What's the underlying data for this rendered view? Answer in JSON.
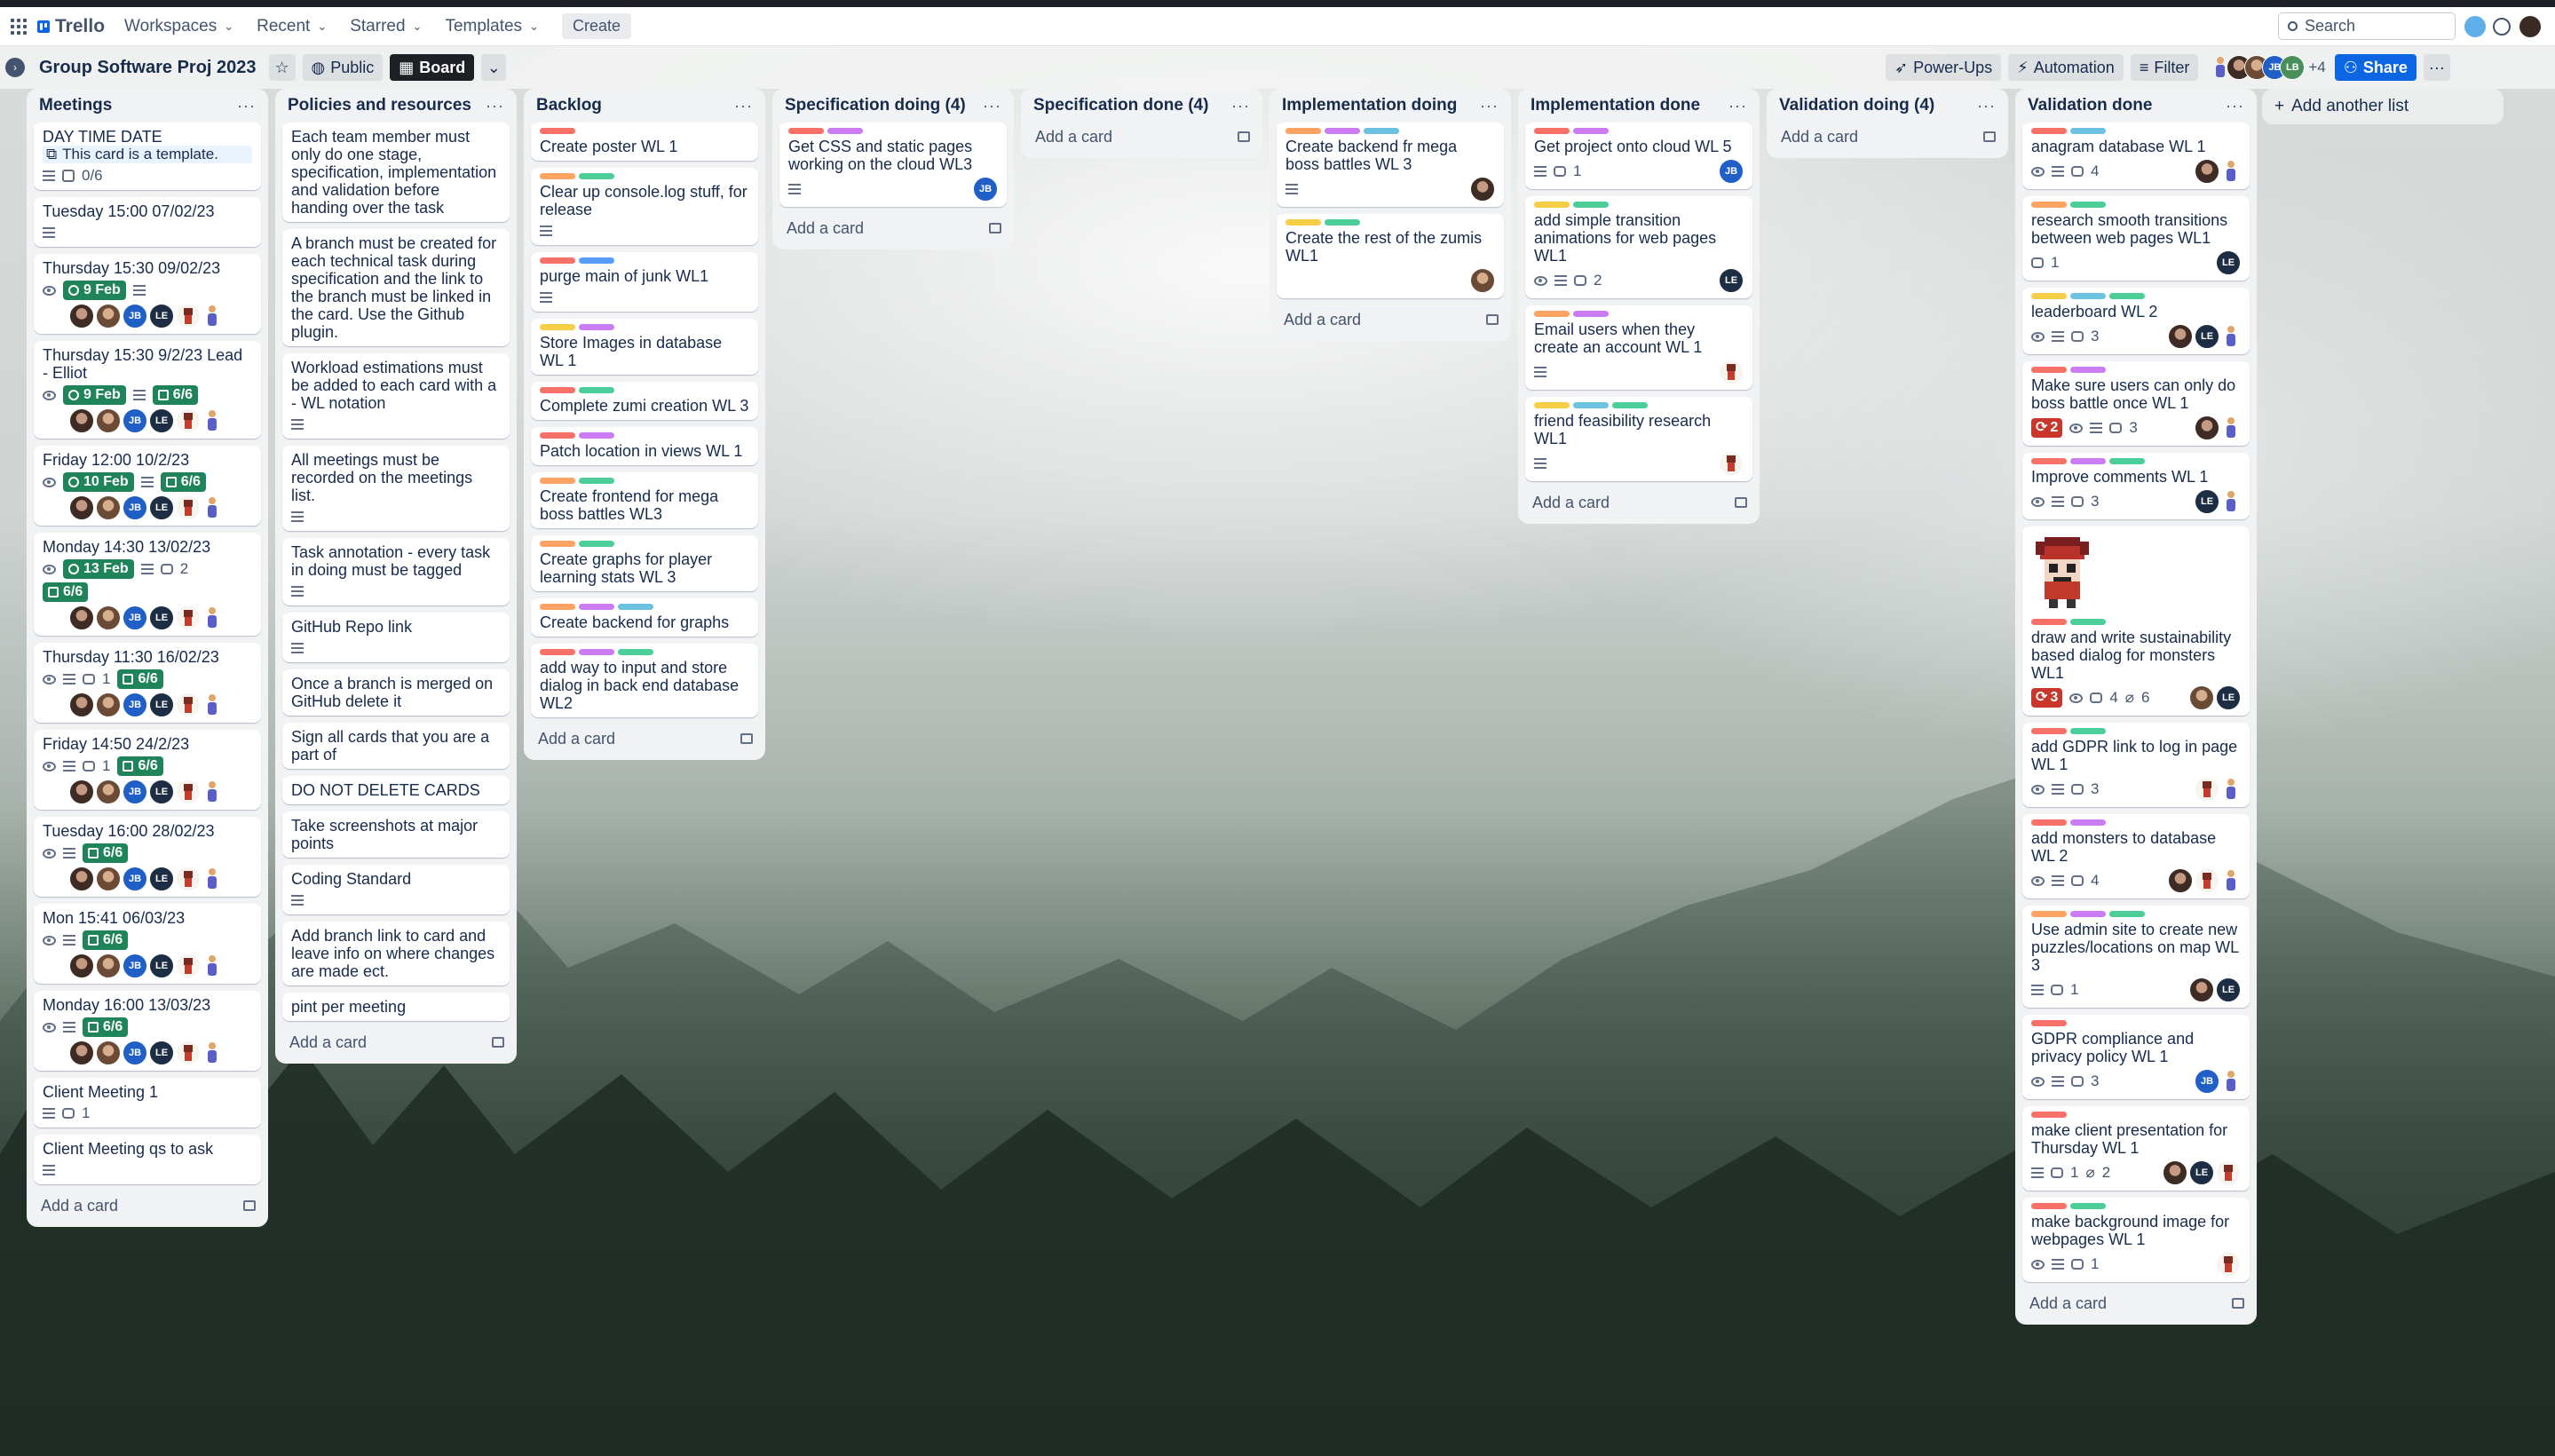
{
  "header": {
    "app_name": "Trello",
    "nav": [
      "Workspaces",
      "Recent",
      "Starred",
      "Templates"
    ],
    "create_label": "Create",
    "search_placeholder": "Search"
  },
  "board": {
    "title": "Group Software Proj 2023",
    "visibility": "Public",
    "view": "Board",
    "power_ups": "Power-Ups",
    "automation": "Automation",
    "filter": "Filter",
    "share": "Share",
    "members_extra": "+4",
    "member_initials": [
      "JB",
      "LB"
    ],
    "add_list": "Add another list",
    "add_card": "Add a card"
  },
  "lists": [
    {
      "title": "Meetings",
      "cards": [
        {
          "title": "DAY TIME DATE",
          "template": "This card is a template.",
          "checklist": "0/6"
        },
        {
          "title": "Tuesday 15:00 07/02/23"
        },
        {
          "title": "Thursday 15:30 09/02/23",
          "due": "9 Feb"
        },
        {
          "title": "Thursday 15:30 9/2/23 Lead - Elliot",
          "due": "9 Feb",
          "checklist": "6/6"
        },
        {
          "title": "Friday 12:00 10/2/23",
          "due": "10 Feb",
          "checklist": "6/6"
        },
        {
          "title": "Monday 14:30 13/02/23",
          "due": "13 Feb",
          "comments": "2",
          "checklist": "6/6"
        },
        {
          "title": "Thursday 11:30 16/02/23",
          "comments": "1",
          "checklist": "6/6"
        },
        {
          "title": "Friday 14:50 24/2/23",
          "comments": "1",
          "checklist": "6/6"
        },
        {
          "title": "Tuesday 16:00 28/02/23",
          "checklist": "6/6"
        },
        {
          "title": "Mon 15:41 06/03/23",
          "checklist": "6/6"
        },
        {
          "title": "Monday 16:00 13/03/23",
          "checklist": "6/6"
        },
        {
          "title": "Client Meeting 1",
          "comments": "1"
        },
        {
          "title": "Client Meeting qs to ask"
        }
      ]
    },
    {
      "title": "Policies and resources",
      "cards": [
        {
          "title": "Each team member must only do one stage, specification, implementation and validation before handing over the task"
        },
        {
          "title": "A branch must be created for each technical task during specification and the link to the branch must be linked in the card. Use the Github plugin."
        },
        {
          "title": "Workload estimations must be added to each card with a - WL notation"
        },
        {
          "title": "All meetings must be recorded on the meetings list."
        },
        {
          "title": "Task annotation - every task in doing must be tagged"
        },
        {
          "title": "GitHub Repo link"
        },
        {
          "title": "Once a branch is merged on GitHub delete it"
        },
        {
          "title": "Sign all cards that you are a part of"
        },
        {
          "title": "DO NOT DELETE CARDS"
        },
        {
          "title": "Take screenshots at major points"
        },
        {
          "title": "Coding Standard"
        },
        {
          "title": "Add branch link to card and leave info on where changes are made ect."
        },
        {
          "title": "pint per meeting"
        }
      ]
    },
    {
      "title": "Backlog",
      "cards": [
        {
          "title": "Create poster WL 1"
        },
        {
          "title": "Clear up console.log stuff, for release"
        },
        {
          "title": "purge main of junk WL1"
        },
        {
          "title": "Store Images in database WL 1"
        },
        {
          "title": "Complete zumi creation WL 3"
        },
        {
          "title": "Patch location in views WL 1"
        },
        {
          "title": "Create frontend for mega boss battles WL3"
        },
        {
          "title": "Create graphs for player learning stats WL 3"
        },
        {
          "title": "Create backend for graphs"
        },
        {
          "title": "add way to input and store dialog in back end database WL2"
        }
      ]
    },
    {
      "title": "Specification doing (4)",
      "cards": [
        {
          "title": "Get CSS and static pages working on the cloud WL3"
        }
      ]
    },
    {
      "title": "Specification done (4)",
      "cards": []
    },
    {
      "title": "Implementation doing",
      "cards": [
        {
          "title": "Create backend fr mega boss battles WL 3"
        },
        {
          "title": "Create the rest of the zumis WL1"
        }
      ]
    },
    {
      "title": "Implementation done",
      "cards": [
        {
          "title": "Get project onto cloud WL 5",
          "comments": "1"
        },
        {
          "title": "add simple transition animations for web pages WL1",
          "comments": "2"
        },
        {
          "title": "Email users when they create an account WL 1"
        },
        {
          "title": "friend feasibility research WL1"
        }
      ]
    },
    {
      "title": "Validation doing (4)",
      "cards": []
    },
    {
      "title": "Validation done",
      "cards": [
        {
          "title": "anagram database WL 1",
          "comments": "4"
        },
        {
          "title": "research smooth transitions between web pages WL1",
          "comments": "1"
        },
        {
          "title": "leaderboard WL 2",
          "comments": "3"
        },
        {
          "title": "Make sure users can only do boss battle once WL 1",
          "alert": "2",
          "comments": "3"
        },
        {
          "title": "Improve comments WL 1",
          "comments": "3"
        },
        {
          "title": "draw and write sustainability based dialog for monsters WL1",
          "alert": "3",
          "comments": "4",
          "attachments": "6"
        },
        {
          "title": "add GDPR link to log in page WL 1",
          "comments": "3"
        },
        {
          "title": "add monsters to database WL 2",
          "comments": "4"
        },
        {
          "title": "Use admin site to create new puzzles/locations on map WL 3",
          "comments": "1"
        },
        {
          "title": "GDPR compliance and privacy policy WL 1",
          "comments": "3"
        },
        {
          "title": "make client presentation for Thursday WL 1",
          "comments": "1",
          "attachments": "2"
        },
        {
          "title": "make background image for webpages WL 1",
          "comments": "1"
        }
      ]
    }
  ],
  "colors": {
    "label_red": "#f87168",
    "label_orange": "#fea362",
    "label_yellow": "#f5cd47",
    "label_green": "#4bce97",
    "label_purple": "#c97cf4",
    "label_blue": "#6cc3e0",
    "label_steel": "#579dff",
    "due_green": "#1f845a",
    "share_blue": "#0c66e4"
  }
}
